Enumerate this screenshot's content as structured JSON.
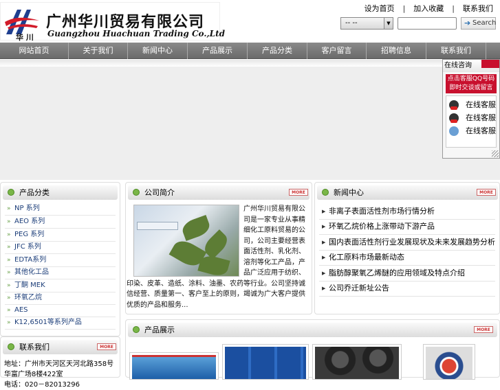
{
  "header": {
    "logo_cn": "广州华川贸易有限公司",
    "logo_en": "Guangzhou Huachuan Trading Co.,Ltd",
    "logo_small": "华 川",
    "top_links": [
      "设为首页",
      "加入收藏",
      "联系我们"
    ],
    "top_sep": "|",
    "lang_value": "-- --",
    "search_placeholder": "",
    "search_label": "Search"
  },
  "nav": [
    "网站首页",
    "关于我们",
    "新闻中心",
    "产品展示",
    "产品分类",
    "客户留言",
    "招聘信息",
    "联系我们"
  ],
  "qq": {
    "title": "在线咨询",
    "prompt_line1": "点击客服QQ号码",
    "prompt_line2": "即时交谈或留言",
    "contacts": [
      "在线客服",
      "在线客服",
      "在线客服"
    ],
    "icons": [
      "qq-penguin-icon",
      "qq-penguin-icon",
      "qq-group-icon"
    ]
  },
  "categories": {
    "title": "产品分类",
    "items": [
      "NP 系列",
      "AEO 系列",
      "PEG 系列",
      "JFC 系列",
      "EDTA系列",
      "其他化工品",
      "丁酮 MEK",
      "环氧乙烷",
      "AES",
      "K12,6501等系列产品"
    ]
  },
  "contact": {
    "title": "联系我们",
    "more": "MORE",
    "line1": "地址：广州市天河区天河北路358号华富广场8楼422室",
    "line2": "电话：020－82013296"
  },
  "about": {
    "title": "公司简介",
    "more": "MORE",
    "text": "广州华川贸易有限公司是一家专业从事精细化工原料贸易的公司，公司主要经营表面活性剂、乳化剂、溶剂等化工产品，产品广泛应用于纺织、印染、皮革、造纸、涂料、油墨、农药等行业。公司坚持诚信经营、质量第一、客户至上的原则，竭诚为广大客户提供优质的产品和服务..."
  },
  "news": {
    "title": "新闻中心",
    "more": "MORE",
    "items": [
      "非离子表面活性剂市场行情分析",
      "环氧乙烷价格上涨带动下游产品",
      "国内表面活性剂行业发展现状及未来发展趋势分析..",
      "化工原料市场最新动态",
      "脂肪醇聚氧乙烯醚的应用领域及特点介绍",
      "公司乔迁新址公告"
    ]
  },
  "products": {
    "title": "产品展示",
    "more": "MORE"
  }
}
